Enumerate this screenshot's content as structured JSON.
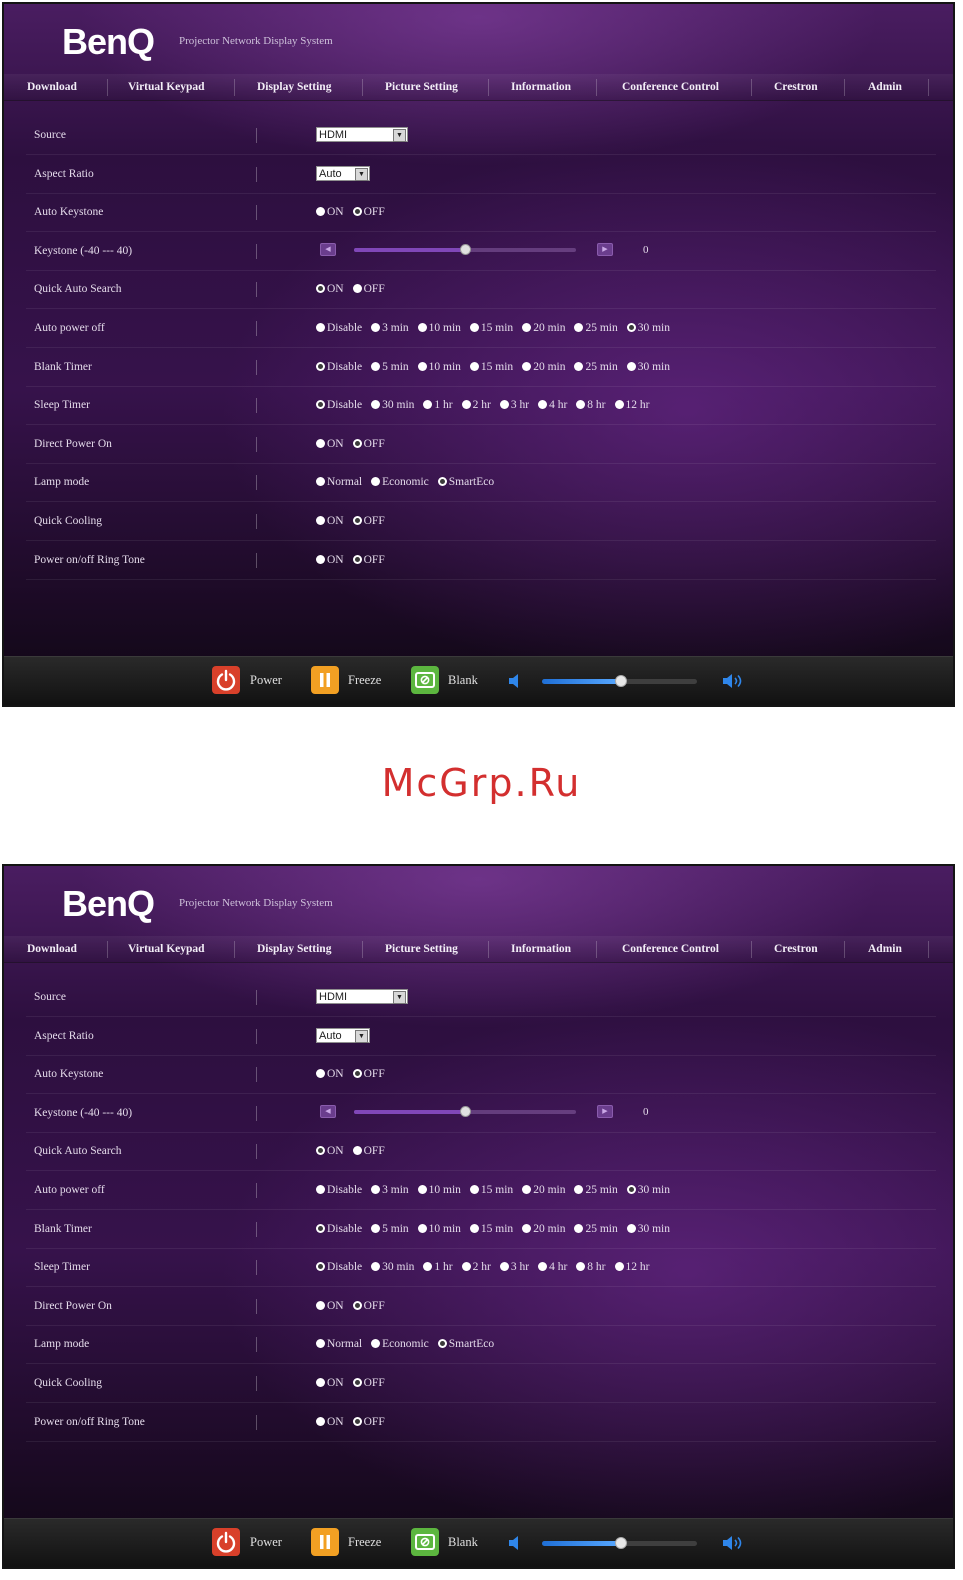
{
  "header": {
    "logo": "BenQ",
    "subtitle": "Projector Network Display System"
  },
  "nav": [
    "Download",
    "Virtual Keypad",
    "Display Setting",
    "Picture Setting",
    "Information",
    "Conference Control",
    "Crestron",
    "Admin"
  ],
  "settings": [
    {
      "label": "Source",
      "type": "select",
      "value": "HDMI",
      "width": 92
    },
    {
      "label": "Aspect Ratio",
      "type": "select",
      "value": "Auto",
      "width": 54
    },
    {
      "label": "Auto Keystone",
      "type": "radio",
      "options": [
        "ON",
        "OFF"
      ],
      "selected": 1
    },
    {
      "label": "Keystone (-40 --- 40)",
      "type": "slider",
      "value": 0,
      "min": -40,
      "max": 40
    },
    {
      "label": "Quick Auto Search",
      "type": "radio",
      "options": [
        "ON",
        "OFF"
      ],
      "selected": 0
    },
    {
      "label": "Auto power off",
      "type": "radio",
      "options": [
        "Disable",
        "3 min",
        "10 min",
        "15 min",
        "20 min",
        "25 min",
        "30 min"
      ],
      "selected": 6
    },
    {
      "label": "Blank Timer",
      "type": "radio",
      "options": [
        "Disable",
        "5 min",
        "10 min",
        "15 min",
        "20 min",
        "25 min",
        "30 min"
      ],
      "selected": 0
    },
    {
      "label": "Sleep Timer",
      "type": "radio",
      "options": [
        "Disable",
        "30 min",
        "1 hr",
        "2 hr",
        "3 hr",
        "4 hr",
        "8 hr",
        "12 hr"
      ],
      "selected": 0
    },
    {
      "label": "Direct Power On",
      "type": "radio",
      "options": [
        "ON",
        "OFF"
      ],
      "selected": 1
    },
    {
      "label": "Lamp mode",
      "type": "radio",
      "options": [
        "Normal",
        "Economic",
        "SmartEco"
      ],
      "selected": 2
    },
    {
      "label": "Quick Cooling",
      "type": "radio",
      "options": [
        "ON",
        "OFF"
      ],
      "selected": 1
    },
    {
      "label": "Power on/off Ring Tone",
      "type": "radio",
      "options": [
        "ON",
        "OFF"
      ],
      "selected": 1
    }
  ],
  "footer": {
    "power": "Power",
    "freeze": "Freeze",
    "blank": "Blank",
    "volume_level": 0.51
  },
  "colors": {
    "power": "#d8402a",
    "freeze": "#f2a023",
    "blank": "#5cb63f",
    "accent": "#3a1453"
  },
  "icons": {
    "power": "power-icon",
    "freeze": "pause-icon",
    "blank": "blank-screen-icon",
    "vol_low": "volume-low-icon",
    "vol_high": "volume-high-icon"
  },
  "watermark": "McGrp.Ru"
}
